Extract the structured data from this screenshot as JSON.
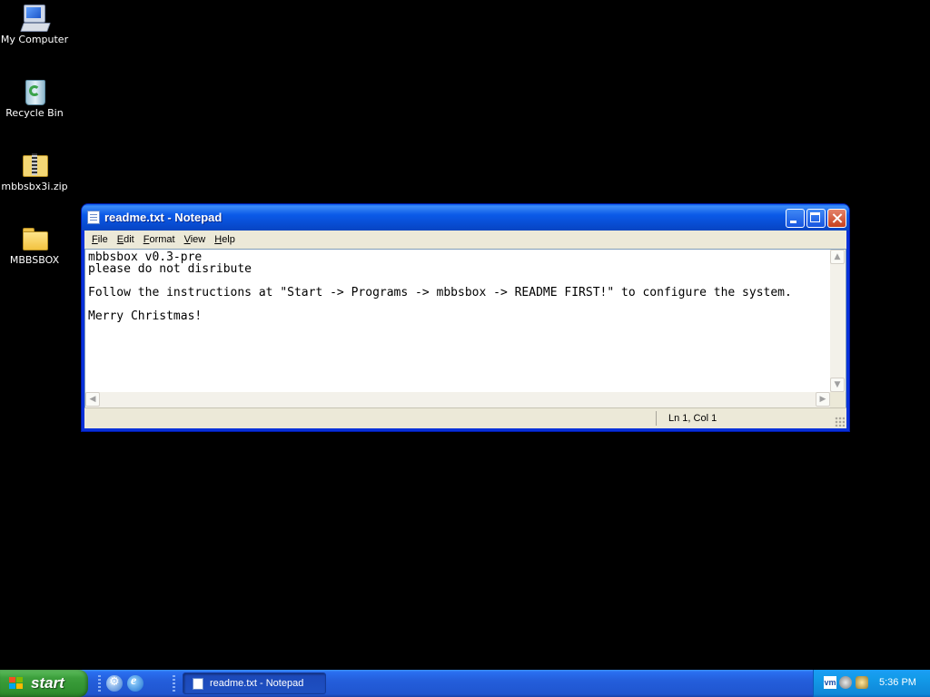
{
  "desktop": {
    "icons": [
      {
        "label": "My Computer",
        "icon": "computer-icon"
      },
      {
        "label": "Recycle Bin",
        "icon": "recycle-bin-icon"
      },
      {
        "label": "mbbsbx3i.zip",
        "icon": "zip-archive-icon"
      },
      {
        "label": "MBBSBOX",
        "icon": "folder-icon"
      }
    ]
  },
  "window": {
    "title": "readme.txt - Notepad",
    "menu": [
      {
        "label": "File",
        "accel": "F",
        "rest": "ile"
      },
      {
        "label": "Edit",
        "accel": "E",
        "rest": "dit"
      },
      {
        "label": "Format",
        "accel": "F",
        "rest": "ormat"
      },
      {
        "label": "View",
        "accel": "V",
        "rest": "iew"
      },
      {
        "label": "Help",
        "accel": "H",
        "rest": "elp"
      }
    ],
    "content": "mbbsbox v0.3-pre\nplease do not disribute\n\nFollow the instructions at \"Start -> Programs -> mbbsbox -> README FIRST!\" to configure the system.\n\nMerry Christmas!",
    "status": "Ln 1, Col 1"
  },
  "taskbar": {
    "start_label": "start",
    "quick_launch": [
      "internet-explorer-icon",
      "media-player-icon"
    ],
    "tasks": [
      {
        "label": "readme.txt - Notepad",
        "icon": "notepad-icon"
      }
    ],
    "tray": {
      "icons": [
        "vmware-tools-icon",
        "volume-icon",
        "network-icon"
      ],
      "vm_badge": "vm",
      "clock": "5:36 PM"
    }
  },
  "colors": {
    "desktop_bg": "#000000",
    "taskbar_blue": "#245edb",
    "start_green": "#3c9f3c",
    "titlebar_blue": "#0b5ae8"
  }
}
